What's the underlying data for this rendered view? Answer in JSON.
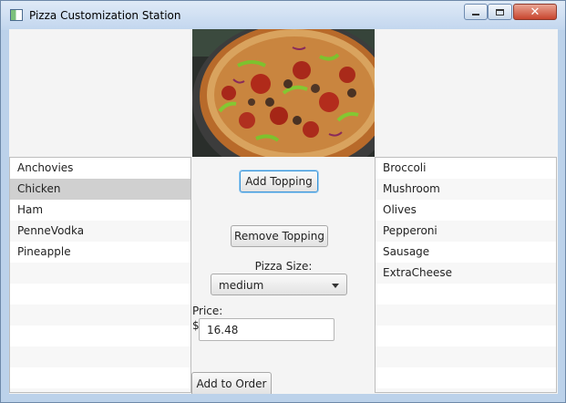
{
  "window": {
    "title": "Pizza Customization Station",
    "minimize_icon": "minimize-icon",
    "maximize_icon": "maximize-icon",
    "close_icon": "close-icon"
  },
  "available_toppings": {
    "items": [
      "Anchovies",
      "Chicken",
      "Ham",
      "PenneVodka",
      "Pineapple"
    ],
    "selected": "Chicken"
  },
  "selected_toppings": {
    "items": [
      "Broccoli",
      "Mushroom",
      "Olives",
      "Pepperoni",
      "Sausage",
      "ExtraCheese"
    ]
  },
  "controls": {
    "add_topping_label": "Add Topping",
    "remove_topping_label": "Remove Topping",
    "size_label": "Pizza Size:",
    "size_value": "medium",
    "price_label": "Price:",
    "currency_symbol": "$",
    "price_value": "16.48",
    "add_to_order_label": "Add to Order"
  },
  "colors": {
    "title_bar": "#c2d6ee",
    "close_button": "#c8452e",
    "selected_row": "#d0d0d0",
    "focus_ring": "#3a94d8"
  }
}
